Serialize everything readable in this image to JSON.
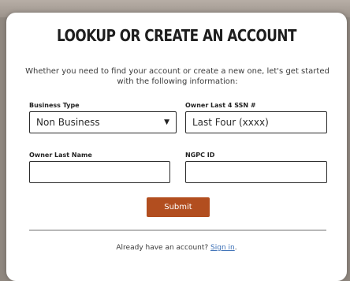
{
  "modal": {
    "title": "LOOKUP OR CREATE AN ACCOUNT",
    "intro_text": "Whether you need to find your account or create a new one, let's get started with the following information:"
  },
  "form": {
    "business_type": {
      "label": "Business Type",
      "selected": "Non Business"
    },
    "owner_ssn": {
      "label": "Owner Last 4 SSN #",
      "placeholder": "Last Four (xxxx)"
    },
    "owner_last_name": {
      "label": "Owner Last Name",
      "value": ""
    },
    "ngpc_id": {
      "label": "NGPC ID",
      "value": ""
    },
    "submit_label": "Submit"
  },
  "footer": {
    "prompt": "Already have an account? ",
    "link_text": "Sign in",
    "suffix": "."
  },
  "colors": {
    "submit_bg": "#b24e1f",
    "link": "#3b6fb6",
    "backdrop": "#8f877f"
  },
  "icons": {
    "select_caret": "caret-down-icon"
  }
}
